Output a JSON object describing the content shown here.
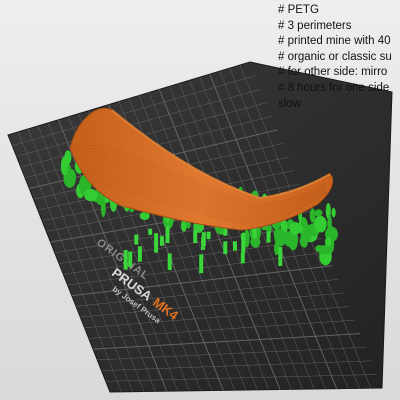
{
  "viewport": {
    "background_color": "#e6e6e6"
  },
  "bed": {
    "color": "#2d2d2d",
    "grid_color": "#6e6e6e",
    "logo": {
      "line1_prefix": "ORIGINAL",
      "line2_brand": "PRUSA",
      "line2_model": "MK4",
      "line3": "by Josef Prusa"
    }
  },
  "model": {
    "part_color": "#d2691e",
    "support_color": "#33cc33"
  },
  "notes": [
    "# PETG",
    "# 3 perimeters",
    "# printed mine with 40",
    "# organic or classic su",
    "# for other side: mirro",
    "# 8 hours for one side",
    "slow"
  ]
}
